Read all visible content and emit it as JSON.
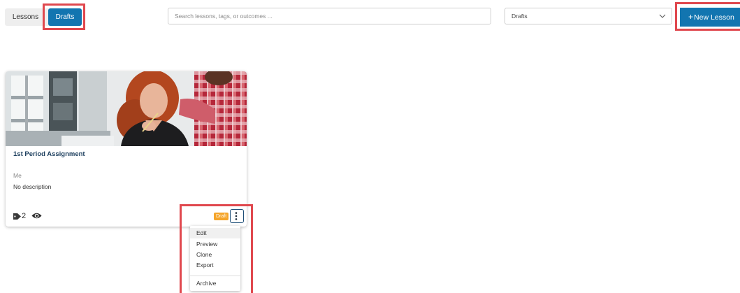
{
  "toolbar": {
    "tabs": [
      {
        "label": "Lessons",
        "active": false
      },
      {
        "label": "Drafts",
        "active": true
      }
    ],
    "search_placeholder": "Search lessons, tags, or outcomes ...",
    "filter_selected": "Drafts",
    "new_button_plus": "+",
    "new_button_label": "New Lesson"
  },
  "card": {
    "title": "1st Period Assignment",
    "author": "Me",
    "description": "No description",
    "tag_count": "2",
    "status_badge": "Draft",
    "tag_icon": "tag-icon",
    "views_icon": "eye-icon",
    "menu_icon": "kebab-icon"
  },
  "menu": {
    "items": [
      "Edit",
      "Preview",
      "Clone",
      "Export",
      "Archive"
    ]
  },
  "colors": {
    "primary": "#1275b0",
    "highlight": "#e0484e",
    "draft_badge": "#f5a52a",
    "title": "#1d3f5e"
  }
}
